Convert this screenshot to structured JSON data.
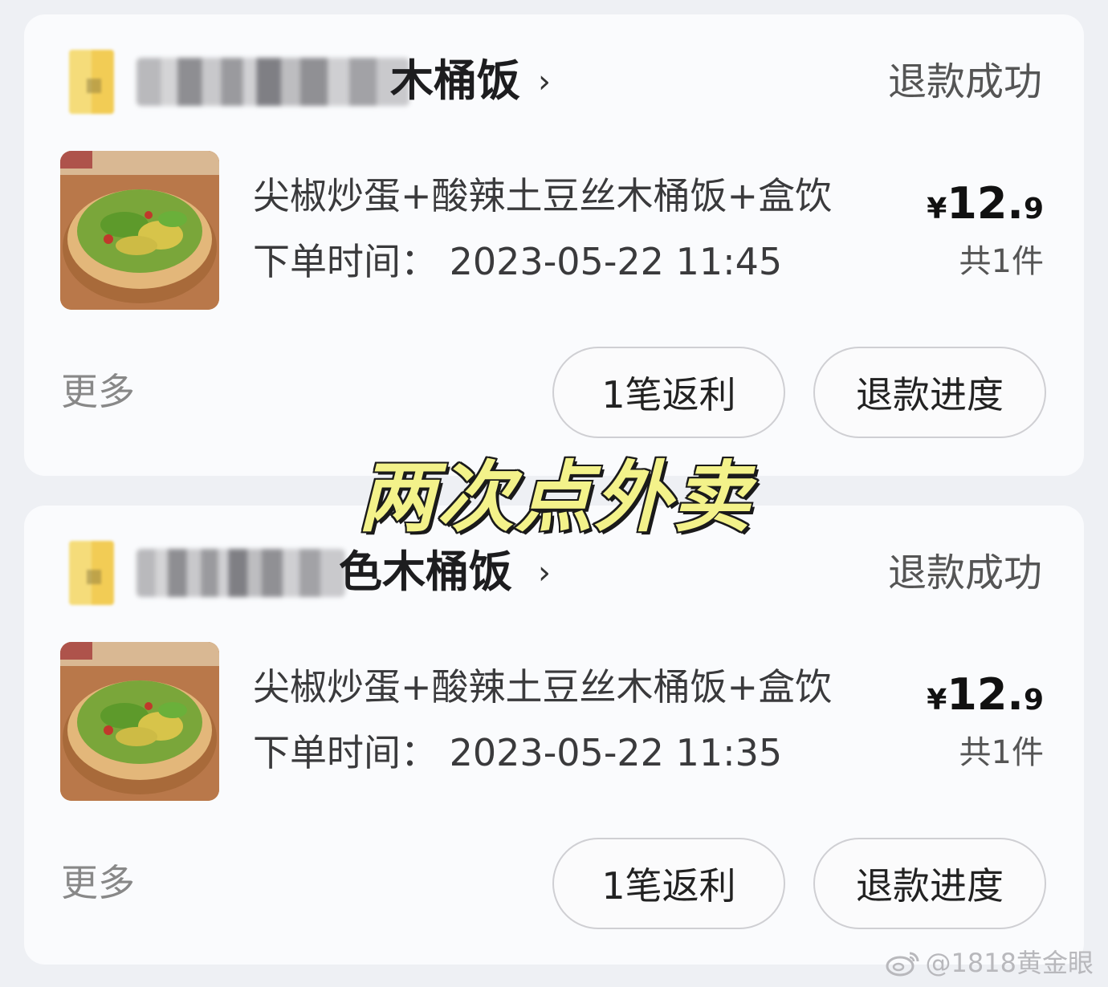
{
  "overlay_caption": "两次点外卖",
  "watermark": "@1818黄金眼",
  "orders": [
    {
      "shop_name_visible": "木桶饭",
      "chevron": "›",
      "status": "退款成功",
      "item_name": "尖椒炒蛋+酸辣土豆丝木桶饭+盒饮",
      "price_currency": "¥",
      "price_integer": "12.",
      "price_decimal": "9",
      "order_time": "下单时间： 2023-05-22 11:45",
      "item_count": "共1件",
      "more_label": "更多",
      "rebate_button": "1笔返利",
      "refund_button": "退款进度"
    },
    {
      "shop_name_visible": "色木桶饭",
      "chevron": "›",
      "status": "退款成功",
      "item_name": "尖椒炒蛋+酸辣土豆丝木桶饭+盒饮",
      "price_currency": "¥",
      "price_integer": "12.",
      "price_decimal": "9",
      "order_time": "下单时间： 2023-05-22 11:35",
      "item_count": "共1件",
      "more_label": "更多",
      "rebate_button": "1笔返利",
      "refund_button": "退款进度"
    }
  ],
  "icons": {
    "shop_logo": "shop-logo-icon",
    "chevron": "chevron-right-icon",
    "food": "food-thumbnail",
    "weibo": "weibo-icon"
  }
}
